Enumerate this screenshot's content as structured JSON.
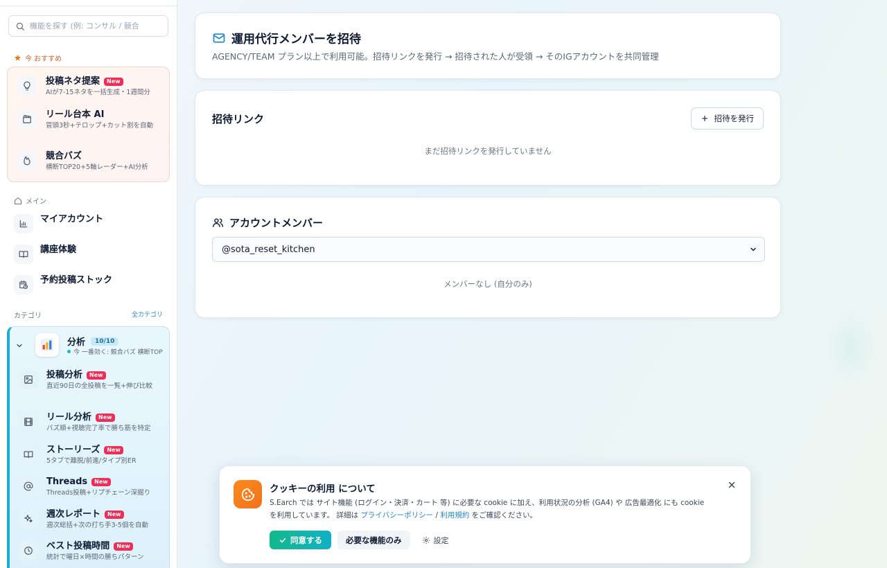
{
  "sidebar": {
    "search": {
      "placeholder": "機能を探す (例: コンサル / 競合"
    },
    "recommended": {
      "label": "今 おすすめ",
      "items": [
        {
          "title": "投稿ネタ提案",
          "badge": "New",
          "sub": "AIが7-15ネタを一括生成・1週間分",
          "icon": "lightbulb-icon"
        },
        {
          "title": "リール台本 AI",
          "badge": "",
          "sub": "冒頭3秒+テロップ+カット割を自動",
          "icon": "clapperboard-icon"
        },
        {
          "title": "競合バズ",
          "badge": "",
          "sub": "横断TOP20+5軸レーダー+AI分析",
          "icon": "flame-icon"
        }
      ]
    },
    "main": {
      "label": "メイン",
      "items": [
        {
          "title": "マイアカウント",
          "icon": "bar-chart-icon"
        },
        {
          "title": "講座体験",
          "icon": "book-icon"
        },
        {
          "title": "予約投稿ストック",
          "icon": "calendar-clock-icon"
        }
      ]
    },
    "categories": {
      "label": "カテゴリ",
      "all_link": "全カテゴリ",
      "group": {
        "name": "分析",
        "count": "10/10",
        "sub": "今 一番効く: 競合バズ 横断TOP",
        "items": [
          {
            "title": "投稿分析",
            "badge": "New",
            "sub": "直近90日の全投稿を一覧+伸び比較",
            "icon": "image-icon"
          },
          {
            "title": "リール分析",
            "badge": "New",
            "sub": "バズ順+視聴完了率で勝ち筋を特定",
            "icon": "film-icon"
          },
          {
            "title": "ストーリーズ",
            "badge": "New",
            "sub": "5タブで離脱/前進/タイプ別ER",
            "icon": "book-open-icon"
          },
          {
            "title": "Threads",
            "badge": "New",
            "sub": "Threads投稿+リプチェーン深掘り",
            "icon": "at-sign-icon"
          },
          {
            "title": "週次レポート",
            "badge": "New",
            "sub": "週次総括+次の打ち手3-5個を自動",
            "icon": "sparkles-icon"
          },
          {
            "title": "ベスト投稿時間",
            "badge": "New",
            "sub": "統計で曜日×時間の勝ちパターン",
            "icon": "clock-icon"
          }
        ]
      }
    }
  },
  "invite_card": {
    "title": "運用代行メンバーを招待",
    "sub": "AGENCY/TEAM プラン以上で利用可能。招待リンクを発行 → 招待された人が受領 → そのIGアカウントを共同管理"
  },
  "links_card": {
    "title": "招待リンク",
    "button": "招待を発行",
    "empty": "まだ招待リンクを発行していません"
  },
  "members_card": {
    "title": "アカウントメンバー",
    "selected_account": "@sota_reset_kitchen",
    "empty": "メンバーなし (自分のみ)"
  },
  "cookie": {
    "title": "クッキーの利用 について",
    "body_1": "S.Earch では サイト機能 (ログイン・決済・カート 等) に必要な cookie に加え、利用状況の分析 (GA4) や 広告最適化 にも cookie を利用しています。 詳細は ",
    "privacy_link": "プライバシーポリシー",
    "separator": " / ",
    "terms_link": "利用規約",
    "body_2": " をご確認ください。",
    "agree": "同意する",
    "essential": "必要な機能のみ",
    "settings": "設定"
  },
  "colors": {
    "accent": "#1aaed6",
    "new_badge": "#ef2d56",
    "agree_start": "#12b98a",
    "agree_end": "#12b0c6",
    "cookie_icon": "#f0711b",
    "link": "#1f86c6"
  }
}
